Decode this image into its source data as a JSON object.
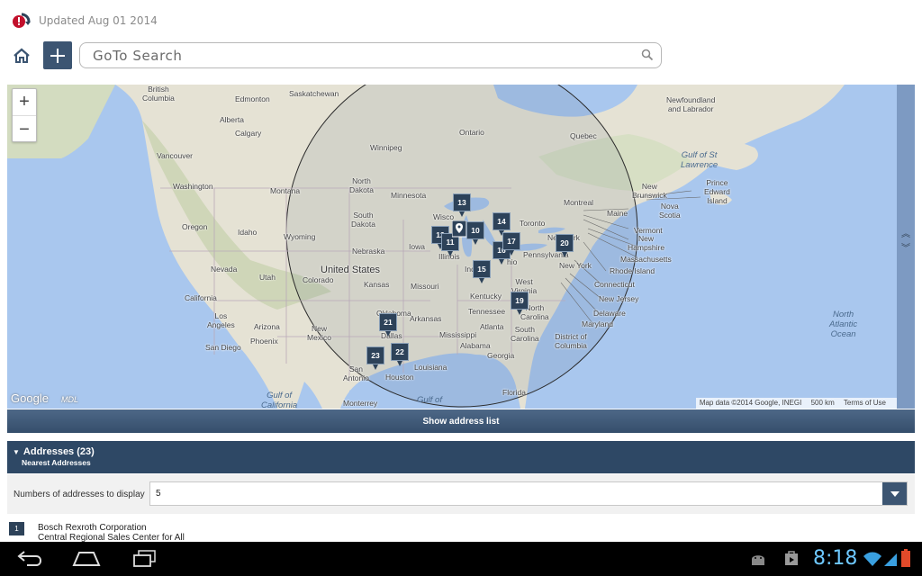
{
  "header": {
    "updated_text": "Updated Aug 01 2014",
    "search_placeholder": "GoTo Search"
  },
  "map": {
    "zoom_in": "+",
    "zoom_out": "−",
    "google_label": "Google",
    "mdl_label": "MDL",
    "attribution": "Map data ©2014 Google, INEGI",
    "scale": "500 km",
    "terms": "Terms of Use",
    "labels": {
      "british_columbia": "British\nColumbia",
      "edmonton": "Edmonton",
      "saskatchewan": "Saskatchewan",
      "alberta": "Alberta",
      "calgary": "Calgary",
      "vancouver": "Vancouver",
      "winnipeg": "Winnipeg",
      "ontario": "Ontario",
      "quebec": "Quebec",
      "newfoundland": "Newfoundland\nand Labrador",
      "gulf_st_lawrence": "Gulf of St\nLawrence",
      "washington": "Washington",
      "montana": "Montana",
      "north_dakota": "North\nDakota",
      "minnesota": "Minnesota",
      "new_brunswick": "New\nBrunswick",
      "pei": "Prince\nEdward\nIsland",
      "nova_scotia": "Nova\nScotia",
      "oregon": "Oregon",
      "idaho": "Idaho",
      "wyoming": "Wyoming",
      "south_dakota": "South\nDakota",
      "wisconsin": "Wisco",
      "toronto": "Toronto",
      "montreal": "Montreal",
      "maine": "Maine",
      "vermont": "Vermont",
      "new_york_state": "New York",
      "new_hampshire": "New\nHampshire",
      "iowa": "Iowa",
      "nebraska": "Nebraska",
      "illinois": "Illinois",
      "pennsylvania": "Pennsylvania",
      "massachusetts": "Massachusetts",
      "rhode_island": "Rhode Island",
      "nevada": "Nevada",
      "utah": "Utah",
      "united_states": "United States",
      "colorado": "Colorado",
      "kansas": "Kansas",
      "missouri": "Missouri",
      "ind": "Ind",
      "ohio": "hio",
      "new_york_city": "New York",
      "connecticut": "Connecticut",
      "west_virginia": "West\nVirginia",
      "new_jersey": "New Jersey",
      "california": "California",
      "kentucky": "Kentucky",
      "north_carolina": "North\nCarolina",
      "delaware": "Delaware",
      "los_angeles": "Los\nAngeles",
      "arizona": "Arizona",
      "oklahoma": "Oklahoma",
      "arkansas": "Arkansas",
      "tennessee": "Tennessee",
      "maryland": "Maryland",
      "new_mexico": "New\nMexico",
      "san_diego": "San Diego",
      "phoenix": "Phoenix",
      "dallas": "Dallas",
      "mississippi": "Mississippi",
      "alabama": "Alabama",
      "atlanta": "Atlanta",
      "south_carolina": "South\nCarolina",
      "district_of_columbia": "District of\nColumbia",
      "north_atlantic_ocean": "North\nAtlantic\nOcean",
      "georgia": "Georgia",
      "louisiana": "Louisiana",
      "san_antonio": "San\nAntonio",
      "houston": "Houston",
      "florida": "Florida",
      "gulf_california": "Gulf of\nCalifornia",
      "monterrey": "Monterrey",
      "gulf_mexico": "Gulf of"
    },
    "pins": [
      "13",
      "12",
      "10",
      "11",
      "14",
      "16",
      "17",
      "20",
      "15",
      "19",
      "21",
      "22",
      "23"
    ]
  },
  "address_list": {
    "show_button": "Show address list",
    "title": "Addresses (23)",
    "subtitle": "Nearest Addresses",
    "count_label": "Numbers of addresses to display",
    "count_value": "5",
    "results": [
      {
        "number": "1",
        "name": "Bosch Rexroth Corporation",
        "subtitle": "Central Regional Sales Center for All"
      }
    ]
  },
  "status_bar": {
    "time": "8:18"
  },
  "colors": {
    "accent": "#3c5572",
    "header_dark": "#2e4865",
    "pin": "#2d4259",
    "water": "#a9c7ee",
    "land": "#e6e2d6",
    "clock": "#6ec8ff"
  }
}
